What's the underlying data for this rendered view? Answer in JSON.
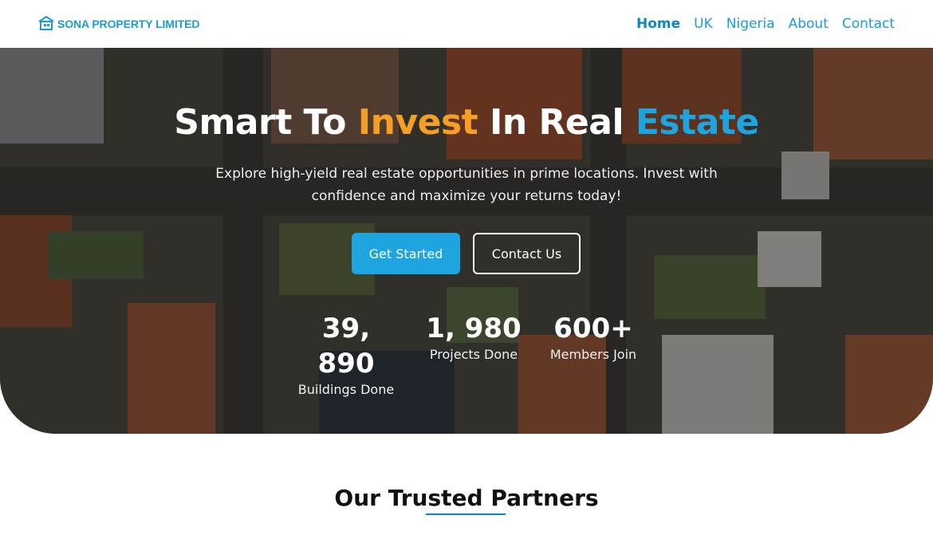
{
  "brand": {
    "name": "SONA PROPERTY LIMITED",
    "color": "#1a9bd7",
    "logo_icon": "house-icon"
  },
  "nav": {
    "items": [
      {
        "label": "Home",
        "active": true
      },
      {
        "label": "UK",
        "active": false
      },
      {
        "label": "Nigeria",
        "active": false
      },
      {
        "label": "About",
        "active": false
      },
      {
        "label": "Contact",
        "active": false
      }
    ]
  },
  "hero": {
    "title_part1": "Smart To ",
    "title_accent1": "Invest",
    "title_part2": " In Real ",
    "title_accent2": "Estate",
    "subtitle": "Explore high-yield real estate opportunities in prime locations. Invest with confidence and maximize your returns today!",
    "primary_button": "Get Started",
    "secondary_button": "Contact Us",
    "background_image": "aerial-view-houses-image",
    "accent_orange": "#f5a025",
    "accent_blue": "#1ea5e0"
  },
  "stats": [
    {
      "value": "39, 890",
      "label": "Buildings Done"
    },
    {
      "value": "1, 980",
      "label": "Projects Done"
    },
    {
      "value": "600+",
      "label": "Members Join"
    }
  ],
  "partners": {
    "title": "Our Trusted Partners"
  }
}
